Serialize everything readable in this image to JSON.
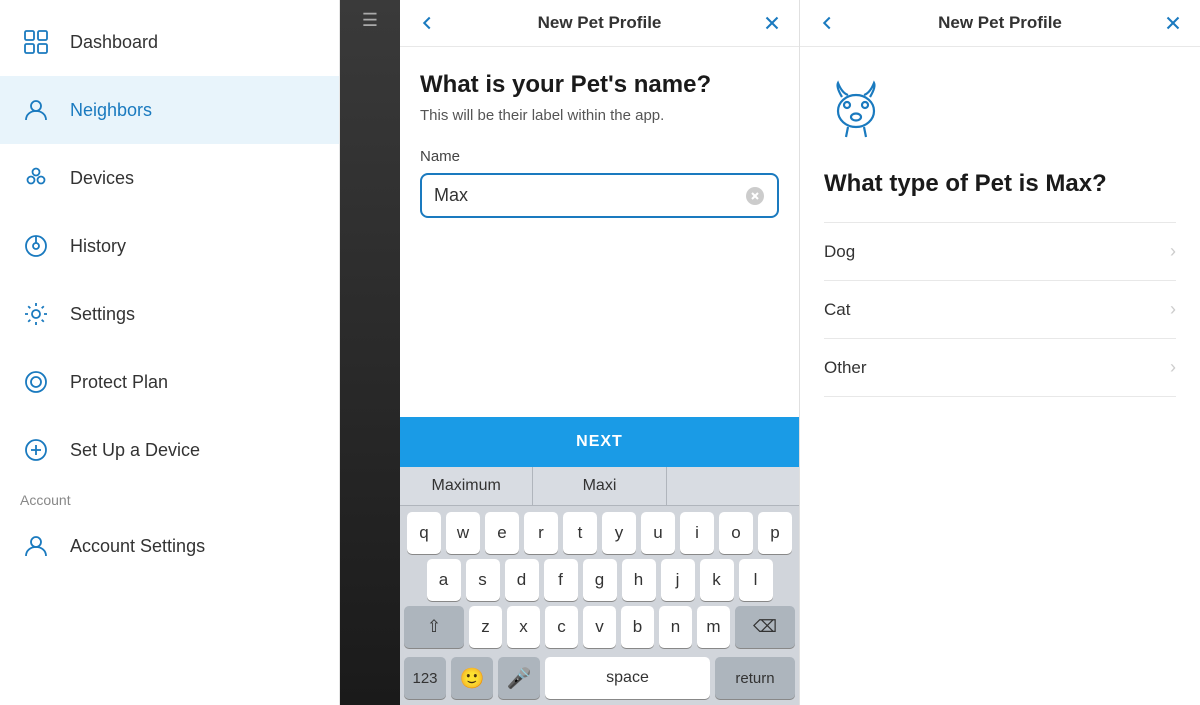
{
  "sidebar": {
    "items": [
      {
        "id": "dashboard",
        "label": "Dashboard",
        "active": false
      },
      {
        "id": "neighbors",
        "label": "Neighbors",
        "active": true
      },
      {
        "id": "devices",
        "label": "Devices",
        "active": false
      },
      {
        "id": "history",
        "label": "History",
        "active": false
      },
      {
        "id": "settings",
        "label": "Settings",
        "active": false
      },
      {
        "id": "protect-plan",
        "label": "Protect Plan",
        "active": false
      },
      {
        "id": "set-up-device",
        "label": "Set Up a Device",
        "active": false
      }
    ],
    "account_label": "Account",
    "account_items": [
      {
        "id": "account-settings",
        "label": "Account Settings"
      }
    ]
  },
  "modal_left": {
    "title": "New Pet Profile",
    "heading": "What is your Pet's name?",
    "subtext": "This will be their label within the app.",
    "name_label": "Name",
    "name_value": "Max",
    "next_button": "NEXT",
    "autocomplete": [
      "Maximum",
      "Maxi"
    ],
    "keyboard": {
      "row1": [
        "q",
        "w",
        "e",
        "r",
        "t",
        "y",
        "u",
        "i",
        "o",
        "p"
      ],
      "row2": [
        "a",
        "s",
        "d",
        "f",
        "g",
        "h",
        "j",
        "k",
        "l"
      ],
      "row3": [
        "z",
        "x",
        "c",
        "v",
        "b",
        "n",
        "m"
      ],
      "bottom": {
        "numbers": "123",
        "space": "space",
        "return": "return"
      }
    }
  },
  "modal_right": {
    "title": "New Pet Profile",
    "pet_name": "Max",
    "heading_template": "What type of Pet is Max?",
    "pet_types": [
      {
        "label": "Dog"
      },
      {
        "label": "Cat"
      },
      {
        "label": "Other"
      }
    ]
  },
  "colors": {
    "accent": "#1a9be6",
    "sidebar_active_bg": "#e8f4fb",
    "sidebar_active_color": "#1a7abf"
  }
}
